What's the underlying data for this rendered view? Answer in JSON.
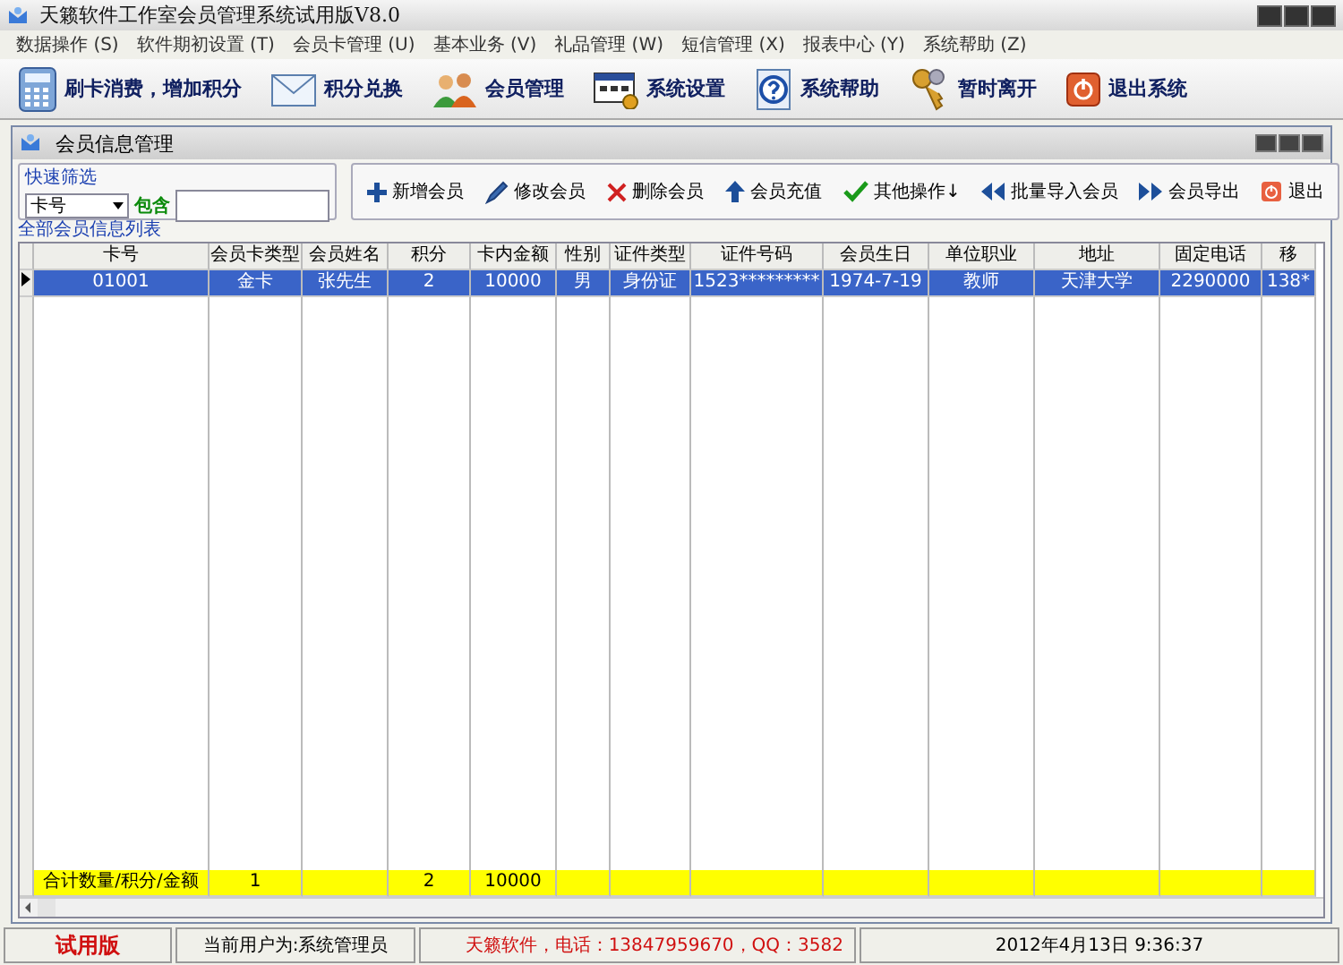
{
  "window": {
    "title": "天籁软件工作室会员管理系统试用版V8.0"
  },
  "menu": [
    {
      "label": "数据操作",
      "key": "(S)"
    },
    {
      "label": "软件期初设置",
      "key": "(T)"
    },
    {
      "label": "会员卡管理",
      "key": "(U)"
    },
    {
      "label": "基本业务",
      "key": "(V)"
    },
    {
      "label": "礼品管理",
      "key": "(W)"
    },
    {
      "label": "短信管理",
      "key": "(X)"
    },
    {
      "label": "报表中心",
      "key": "(Y)"
    },
    {
      "label": "系统帮助",
      "key": "(Z)"
    }
  ],
  "toolbar": [
    {
      "label": "刷卡消费，增加积分",
      "kind": "card"
    },
    {
      "label": "积分兑换",
      "kind": "mail"
    },
    {
      "label": "会员管理",
      "kind": "people"
    },
    {
      "label": "系统设置",
      "kind": "settings"
    },
    {
      "label": "系统帮助",
      "kind": "help"
    },
    {
      "label": "暂时离开",
      "kind": "keys"
    },
    {
      "label": "退出系统",
      "kind": "exit"
    }
  ],
  "child_window": {
    "title": "会员信息管理",
    "filter": {
      "title": "快速筛选",
      "field": "卡号",
      "operator": "包含"
    },
    "actions": [
      {
        "label": "新增会员",
        "kind": "add"
      },
      {
        "label": "修改会员",
        "kind": "edit"
      },
      {
        "label": "删除会员",
        "kind": "delete"
      },
      {
        "label": "会员充值",
        "kind": "up"
      },
      {
        "label": "其他操作↓",
        "kind": "check"
      },
      {
        "label": "批量导入会员",
        "kind": "rewind"
      },
      {
        "label": "会员导出",
        "kind": "forward"
      },
      {
        "label": "退出",
        "kind": "exit"
      }
    ],
    "list_title": "全部会员信息列表",
    "table": {
      "columns": [
        "卡号",
        "会员卡类型",
        "会员姓名",
        "积分",
        "卡内金额",
        "性别",
        "证件类型",
        "证件号码",
        "会员生日",
        "单位职业",
        "地址",
        "固定电话",
        "移"
      ],
      "rows": [
        {
          "selected": true,
          "cells": [
            "01001",
            "金卡",
            "张先生",
            "2",
            "10000",
            "男",
            "身份证",
            "1523*********",
            "1974-7-19",
            "教师",
            "天津大学",
            "2290000",
            "138*"
          ]
        }
      ],
      "totals": {
        "label": "合计数量/积分/金额",
        "count": "1",
        "points": "2",
        "amount": "10000"
      }
    }
  },
  "status_bar": {
    "edition": "试用版",
    "user": "当前用户为:系统管理员",
    "contact": "天籁软件，电话：13847959670，QQ：3582",
    "datetime": "2012年4月13日 9:36:37"
  }
}
